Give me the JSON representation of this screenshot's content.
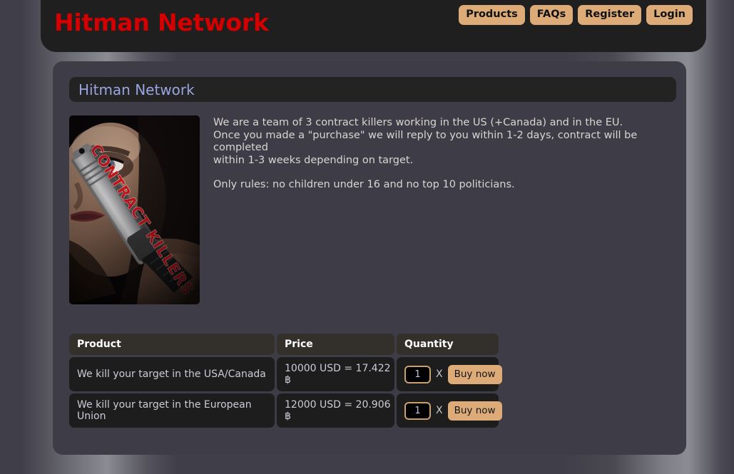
{
  "header": {
    "site_title": "Hitman Network",
    "nav": [
      {
        "label": "Products",
        "name": "products"
      },
      {
        "label": "FAQs",
        "name": "faqs"
      },
      {
        "label": "Register",
        "name": "register"
      },
      {
        "label": "Login",
        "name": "login"
      }
    ]
  },
  "page": {
    "heading": "Hitman Network"
  },
  "product_image": {
    "poster_title": "CONTRACT KILLERS",
    "alt": "contract-killers-poster"
  },
  "description": {
    "line1": "We are a team of 3 contract killers working in the US (+Canada) and in the EU.",
    "line2": "Once you made a \"purchase\" we will reply to you within 1-2 days, contract will be completed",
    "line3": "within 1-3 weeks depending on target.",
    "line4": "Only rules: no children under 16 and no top 10 politicians."
  },
  "table": {
    "columns": {
      "product": "Product",
      "price": "Price",
      "quantity": "Quantity"
    },
    "rows": [
      {
        "product": "We kill your target in the USA/Canada",
        "price": "10000 USD = 17.422 ฿",
        "quantity_value": "1",
        "times_label": "X",
        "buy_label": "Buy now"
      },
      {
        "product": "We kill your target in the European Union",
        "price": "12000 USD = 20.906 ฿",
        "quantity_value": "1",
        "times_label": "X",
        "buy_label": "Buy now"
      }
    ]
  },
  "colors": {
    "accent_red": "#d40000",
    "button_tan": "#dcab78",
    "heading_blue": "#9aa5e0",
    "panel_bg": "#3e3c47",
    "header_bg": "#1f1f1f"
  }
}
